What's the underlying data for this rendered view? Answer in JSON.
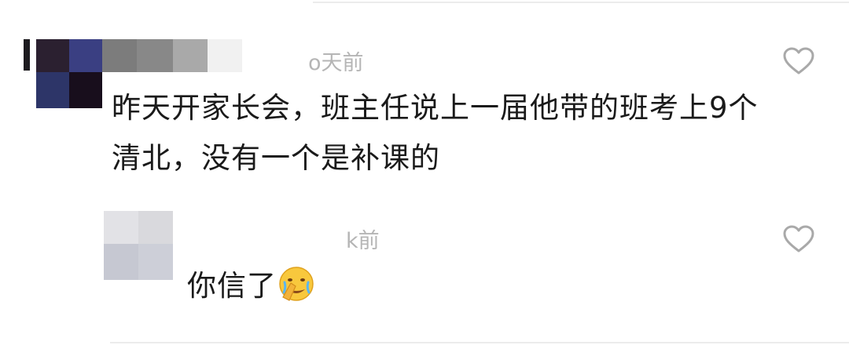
{
  "comments": [
    {
      "timestamp": "o天前",
      "text_line1": "昨天开家长会，班主任说上一届他带的班考上9个",
      "text_line2": "清北，没有一个是补课的",
      "like_icon": "heart-outline-icon"
    },
    {
      "timestamp": "k前",
      "text": "你信了",
      "emoji": "face-palm-crying-emoji",
      "like_icon": "heart-outline-icon"
    }
  ],
  "colors": {
    "timestamp": "#b5b5b5",
    "text": "#1a1a1a",
    "heart": "#a9a9a9",
    "divider": "#ececec"
  }
}
